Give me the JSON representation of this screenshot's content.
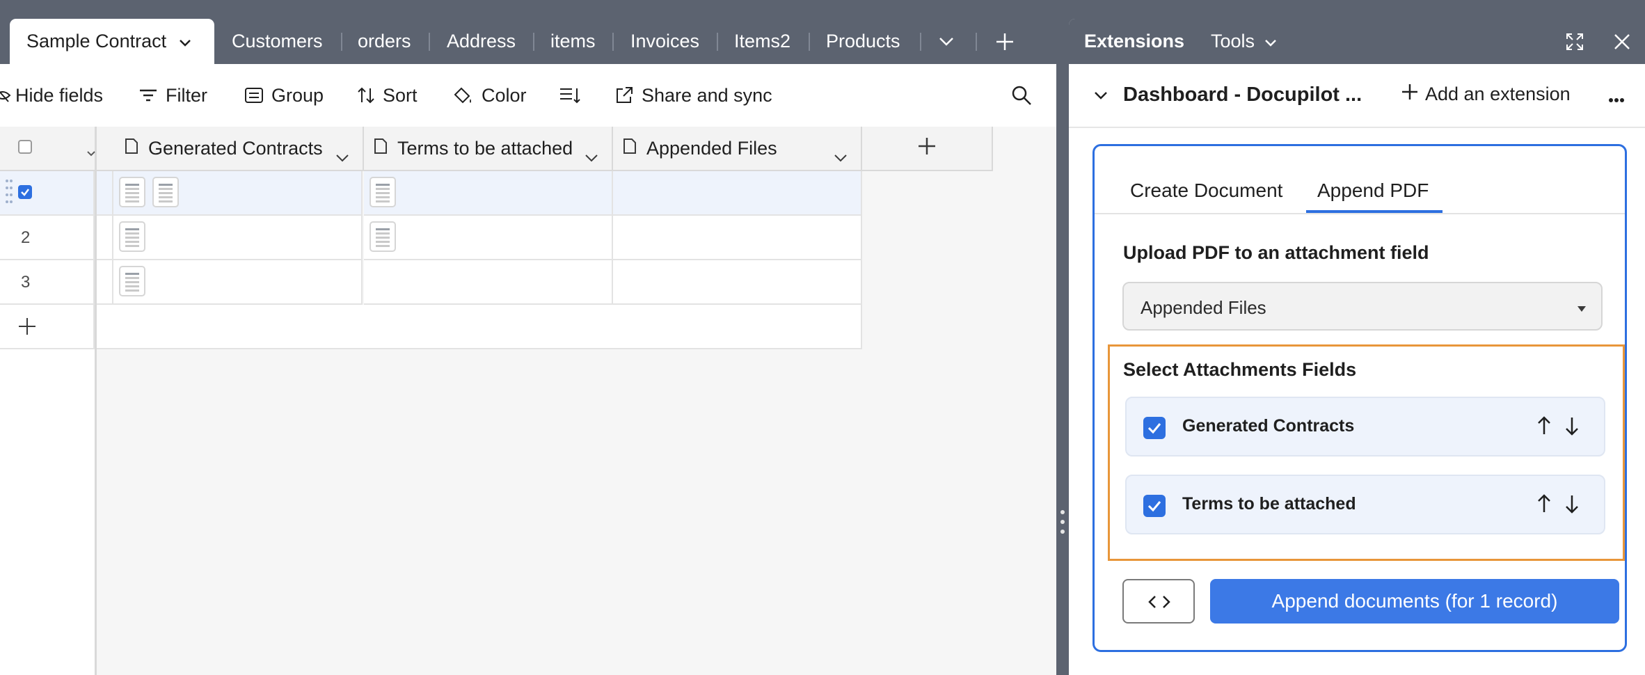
{
  "tabs": {
    "active": "Sample Contract",
    "items": [
      "Customers",
      "orders",
      "Address",
      "items",
      "Invoices",
      "Items2",
      "Products"
    ]
  },
  "toolbar": {
    "hide_fields": "Hide fields",
    "filter": "Filter",
    "group": "Group",
    "sort": "Sort",
    "color": "Color",
    "share": "Share and sync"
  },
  "grid": {
    "columns": [
      "Generated Contracts",
      "Terms to be attached",
      "Appended Files"
    ],
    "rows": [
      {
        "num": "",
        "selected": true,
        "generated_thumbs": 2,
        "terms_thumbs": 1
      },
      {
        "num": "2",
        "selected": false,
        "generated_thumbs": 1,
        "terms_thumbs": 1
      },
      {
        "num": "3",
        "selected": false,
        "generated_thumbs": 1,
        "terms_thumbs": 0
      }
    ]
  },
  "extensions": {
    "title": "Extensions",
    "tools": "Tools",
    "dashboard_title": "Dashboard - Docupilot ...",
    "add_extension": "Add an extension",
    "subtabs": [
      "Create Document",
      "Append PDF"
    ],
    "active_subtab": "Append PDF",
    "upload_label": "Upload PDF to an attachment field",
    "upload_select_value": "Appended Files",
    "select_fields_label": "Select Attachments Fields",
    "fields": [
      "Generated Contracts",
      "Terms to be attached"
    ],
    "append_button": "Append documents (for 1 record)"
  },
  "colors": {
    "accent": "#2d6fe0",
    "highlight_border": "#e8963a",
    "chrome": "#5c6370"
  }
}
